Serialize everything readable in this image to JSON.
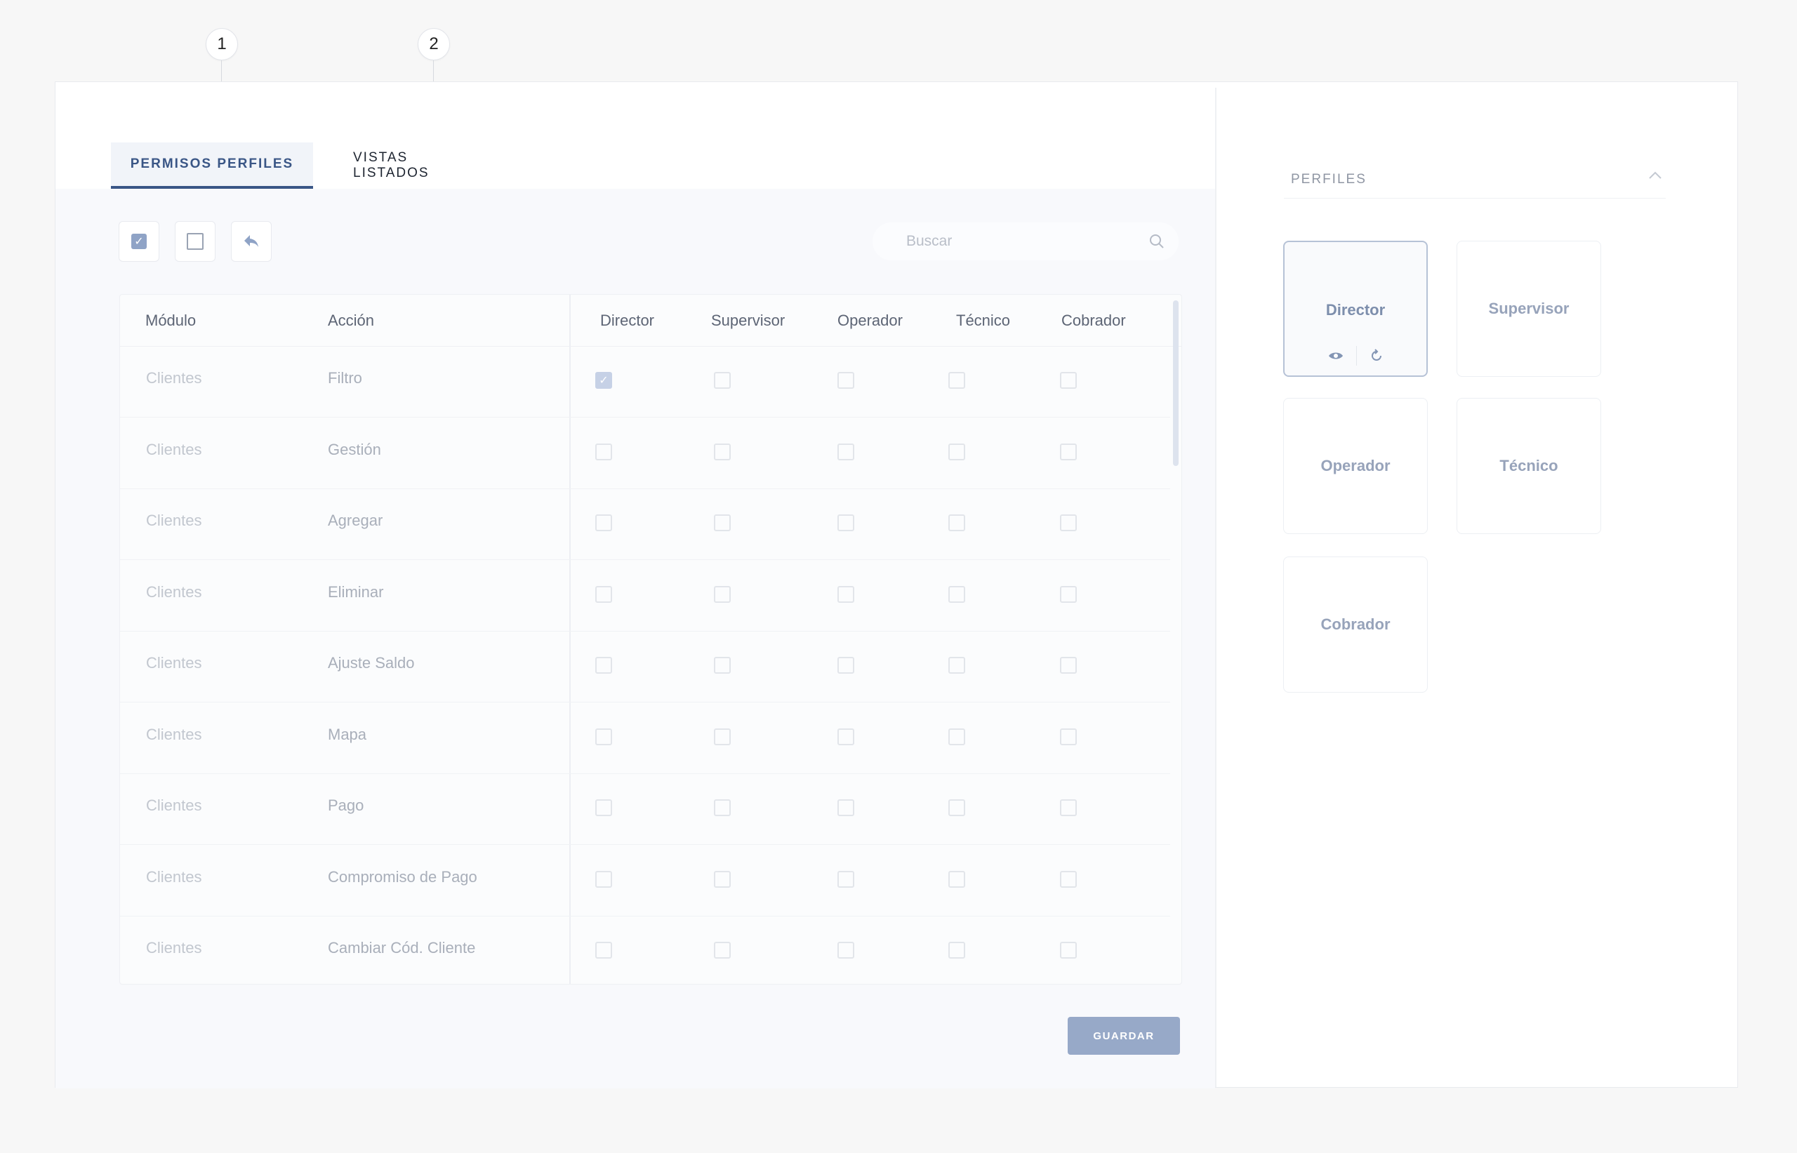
{
  "callouts": [
    "1",
    "2"
  ],
  "tabs": [
    {
      "label": "PERMISOS PERFILES",
      "active": true
    },
    {
      "label": "VISTAS LISTADOS",
      "active": false
    }
  ],
  "toolbar": {
    "select_all_icon": "checkbox-checked-icon",
    "deselect_all_icon": "checkbox-empty-icon",
    "undo_icon": "reply-arrow-icon"
  },
  "search": {
    "placeholder": "Buscar",
    "value": ""
  },
  "table": {
    "columns": [
      "Módulo",
      "Acción",
      "Director",
      "Supervisor",
      "Operador",
      "Técnico",
      "Cobrador"
    ],
    "rows": [
      {
        "module": "Clientes",
        "action": "Filtro",
        "perms": [
          true,
          false,
          false,
          false,
          false
        ]
      },
      {
        "module": "Clientes",
        "action": "Gestión",
        "perms": [
          false,
          false,
          false,
          false,
          false
        ]
      },
      {
        "module": "Clientes",
        "action": "Agregar",
        "perms": [
          false,
          false,
          false,
          false,
          false
        ]
      },
      {
        "module": "Clientes",
        "action": "Eliminar",
        "perms": [
          false,
          false,
          false,
          false,
          false
        ]
      },
      {
        "module": "Clientes",
        "action": "Ajuste Saldo",
        "perms": [
          false,
          false,
          false,
          false,
          false
        ]
      },
      {
        "module": "Clientes",
        "action": "Mapa",
        "perms": [
          false,
          false,
          false,
          false,
          false
        ]
      },
      {
        "module": "Clientes",
        "action": "Pago",
        "perms": [
          false,
          false,
          false,
          false,
          false
        ]
      },
      {
        "module": "Clientes",
        "action": "Compromiso de Pago",
        "perms": [
          false,
          false,
          false,
          false,
          false
        ]
      },
      {
        "module": "Clientes",
        "action": "Cambiar Cód. Cliente",
        "perms": [
          false,
          false,
          false,
          false,
          false
        ]
      }
    ]
  },
  "save_label": "GUARDAR",
  "panel": {
    "title": "PERFILES",
    "profiles": [
      {
        "name": "Director",
        "active": true
      },
      {
        "name": "Supervisor",
        "active": false
      },
      {
        "name": "Operador",
        "active": false
      },
      {
        "name": "Técnico",
        "active": false
      },
      {
        "name": "Cobrador",
        "active": false
      }
    ]
  },
  "colors": {
    "accent": "#3a5686",
    "button": "#97a9c8",
    "checked": "#c6d1e6"
  }
}
